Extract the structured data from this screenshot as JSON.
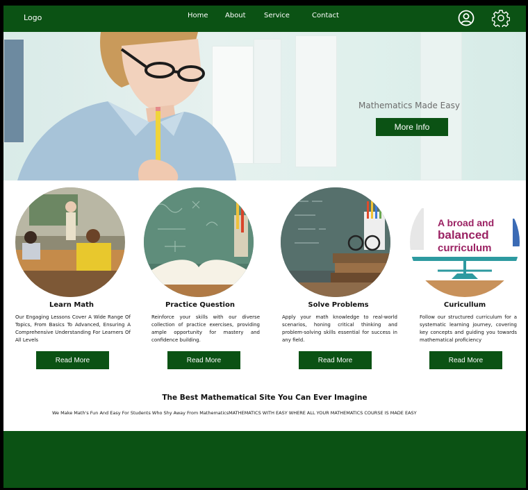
{
  "header": {
    "logo": "Logo",
    "nav": [
      "Home",
      "About",
      "Service",
      "Contact"
    ],
    "icons": [
      "user-icon",
      "settings-icon"
    ]
  },
  "hero": {
    "subtitle": "Mathematics Made Easy",
    "button": "More Info"
  },
  "cards": [
    {
      "title": "Learn Math",
      "text": "Our Engaging Lessons Cover A Wide Range Of Topics, From Basics To Advanced, Ensuring A Comprehensive Understanding For Learners Of All Levels",
      "button": "Read More"
    },
    {
      "title": "Practice  Question",
      "text": "Reinforce your skills with our diverse collection of practice exercises, providing ample opportunity for mastery and confidence building.",
      "button": "Read More"
    },
    {
      "title": "Solve Problems",
      "text": "Apply your math knowledge to real-world scenarios, honing critical thinking and problem-solving skills essential for success in any field.",
      "button": "Read More"
    },
    {
      "title": "Curicullum",
      "text": "Follow our structured curriculum for a systematic learning journey, covering key concepts and guiding you towards mathematical proficiency",
      "button": "Read More",
      "image_text": [
        "A broad and",
        "balanced",
        "curriculum"
      ]
    }
  ],
  "tagline": "The Best  Mathematical Site  You  Can  Ever  Imagine",
  "subline": "We Make Math's Fun And Easy For Students Who Shy Away From MathematicsMATHEMATICS WITH EASY WHERE ALL  YOUR  MATHEMATICS COURSE  IS MADE  EASY",
  "colors": {
    "brand": "#0b5214",
    "background": "#ffffff"
  }
}
